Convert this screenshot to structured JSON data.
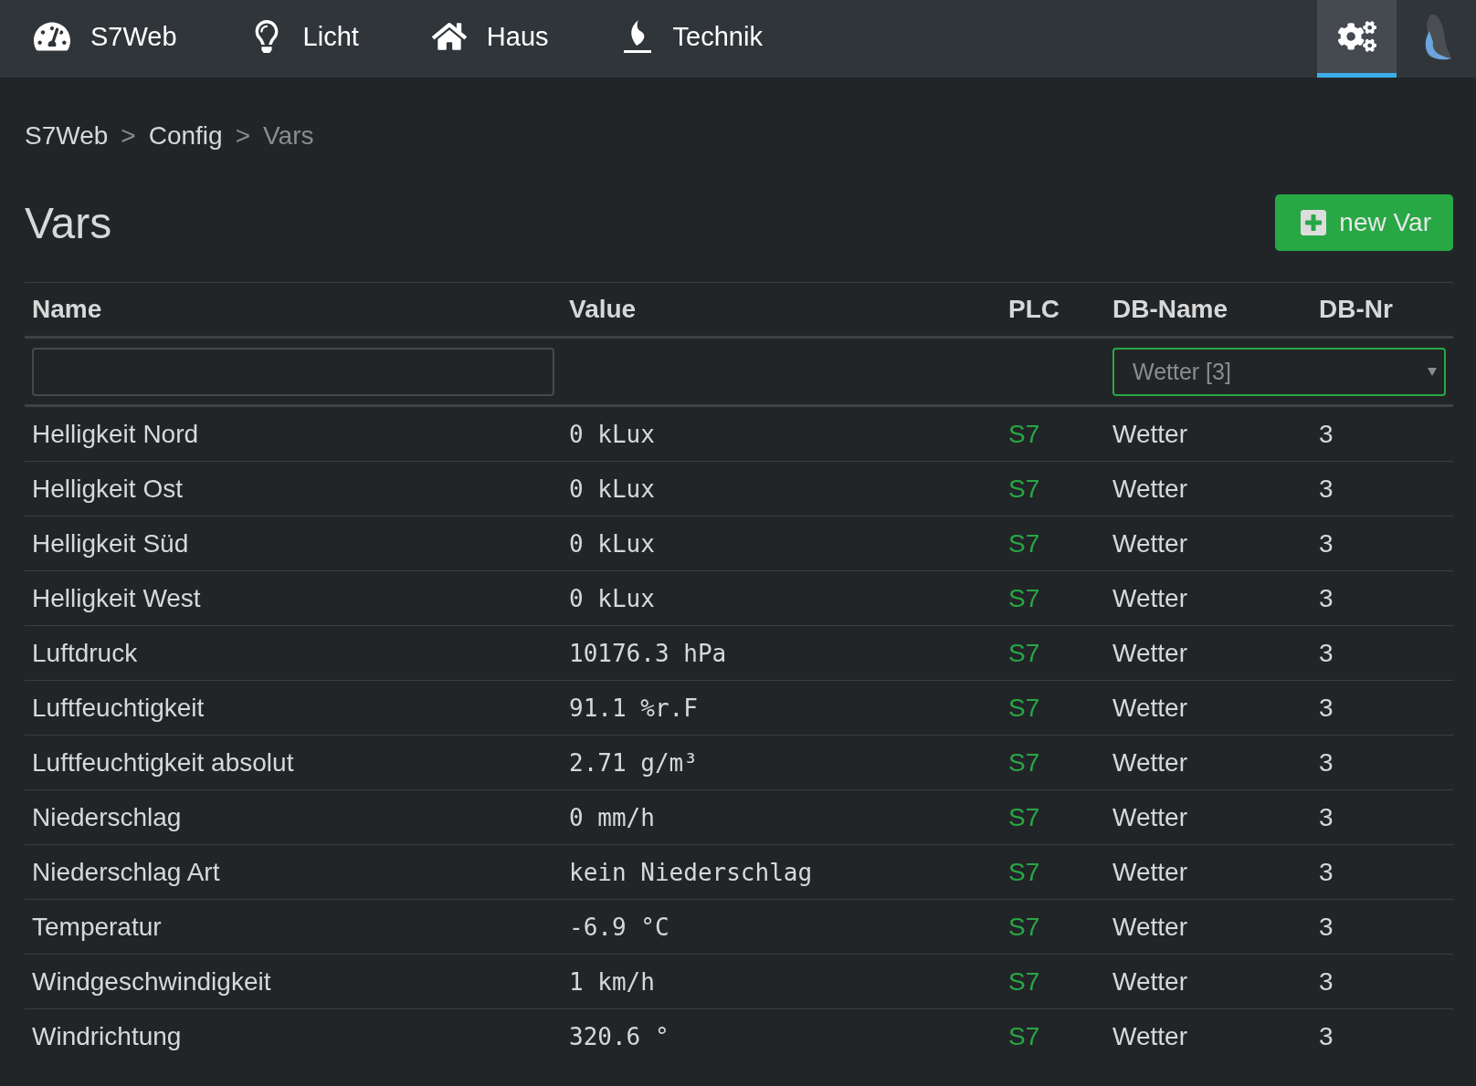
{
  "nav": {
    "items": [
      {
        "label": "S7Web",
        "selected": false
      },
      {
        "label": "Licht",
        "selected": false
      },
      {
        "label": "Haus",
        "selected": false
      },
      {
        "label": "Technik",
        "selected": false
      }
    ],
    "right": [
      {
        "selected": true
      },
      {
        "selected": false
      }
    ]
  },
  "breadcrumb": [
    {
      "label": "S7Web",
      "current": false
    },
    {
      "label": "Config",
      "current": false
    },
    {
      "label": "Vars",
      "current": true
    }
  ],
  "breadcrumb_separator": ">",
  "title": "Vars",
  "new_button": "new Var",
  "table": {
    "columns": [
      "Name",
      "Value",
      "PLC",
      "DB-Name",
      "DB-Nr"
    ],
    "filter": {
      "db_select": "Wetter [3]"
    },
    "rows": [
      {
        "name": "Helligkeit Nord",
        "value": "0 kLux",
        "plc": "S7",
        "db_name": "Wetter",
        "db_nr": "3"
      },
      {
        "name": "Helligkeit Ost",
        "value": "0 kLux",
        "plc": "S7",
        "db_name": "Wetter",
        "db_nr": "3"
      },
      {
        "name": "Helligkeit Süd",
        "value": "0 kLux",
        "plc": "S7",
        "db_name": "Wetter",
        "db_nr": "3"
      },
      {
        "name": "Helligkeit West",
        "value": "0 kLux",
        "plc": "S7",
        "db_name": "Wetter",
        "db_nr": "3"
      },
      {
        "name": "Luftdruck",
        "value": "10176.3 hPa",
        "plc": "S7",
        "db_name": "Wetter",
        "db_nr": "3"
      },
      {
        "name": "Luftfeuchtigkeit",
        "value": "91.1 %r.F",
        "plc": "S7",
        "db_name": "Wetter",
        "db_nr": "3"
      },
      {
        "name": "Luftfeuchtigkeit absolut",
        "value": "2.71 g/m³",
        "plc": "S7",
        "db_name": "Wetter",
        "db_nr": "3"
      },
      {
        "name": "Niederschlag",
        "value": "0 mm/h",
        "plc": "S7",
        "db_name": "Wetter",
        "db_nr": "3"
      },
      {
        "name": "Niederschlag Art",
        "value": "kein Niederschlag",
        "plc": "S7",
        "db_name": "Wetter",
        "db_nr": "3"
      },
      {
        "name": "Temperatur",
        "value": "-6.9 °C",
        "plc": "S7",
        "db_name": "Wetter",
        "db_nr": "3"
      },
      {
        "name": "Windgeschwindigkeit",
        "value": "1 km/h",
        "plc": "S7",
        "db_name": "Wetter",
        "db_nr": "3"
      },
      {
        "name": "Windrichtung",
        "value": "320.6 °",
        "plc": "S7",
        "db_name": "Wetter",
        "db_nr": "3"
      }
    ]
  }
}
